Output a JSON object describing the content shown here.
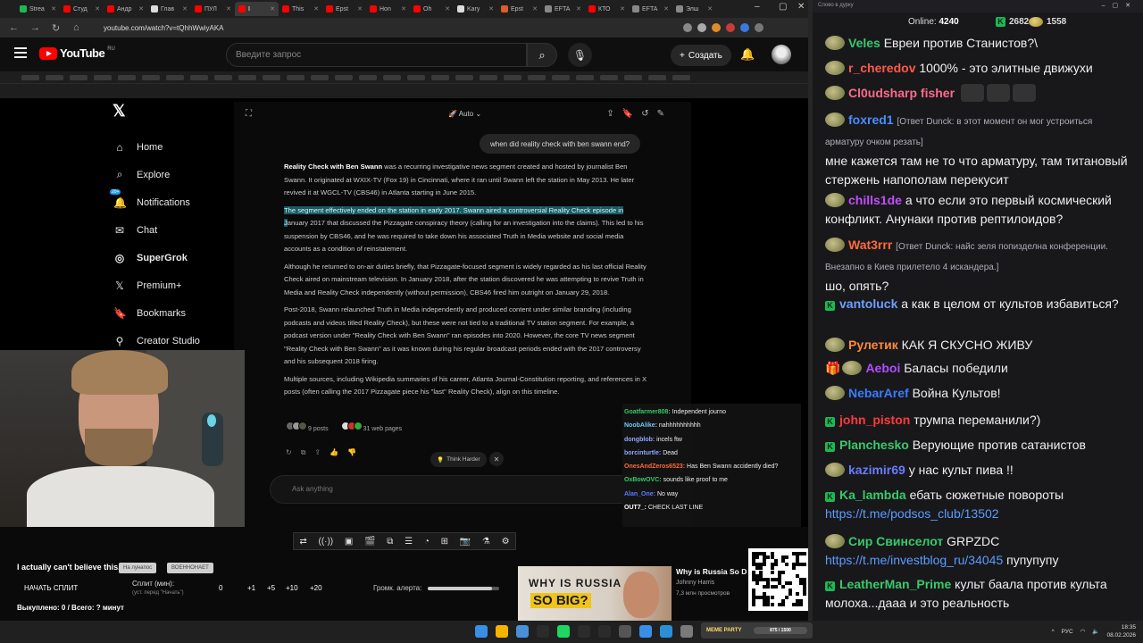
{
  "browser": {
    "tabs": [
      {
        "label": "Strea",
        "color": "#1db954"
      },
      {
        "label": "Студ",
        "color": "#ff0000"
      },
      {
        "label": "Андр",
        "color": "#ff0000"
      },
      {
        "label": "Глав",
        "color": "#dddddd"
      },
      {
        "label": "ПУЛ",
        "color": "#ff0000"
      },
      {
        "label": "I",
        "color": "#ff0000",
        "active": true
      },
      {
        "label": "This",
        "color": "#ff0000"
      },
      {
        "label": "Epst",
        "color": "#ff0000"
      },
      {
        "label": "Hon",
        "color": "#ff0000"
      },
      {
        "label": "Oh",
        "color": "#ff0000"
      },
      {
        "label": "Kary",
        "color": "#dddddd"
      },
      {
        "label": "Epst",
        "color": "#e05a2a"
      },
      {
        "label": "EFTA",
        "color": "#888888"
      },
      {
        "label": "КТО",
        "color": "#ff0000"
      },
      {
        "label": "EFTA",
        "color": "#888888"
      },
      {
        "label": "Элш",
        "color": "#888888"
      }
    ],
    "url": "youtube.com/watch?v=tQhhWwiyAKA",
    "window_controls": [
      "–",
      "▢",
      "✕"
    ]
  },
  "youtube": {
    "logo_text": "YouTube",
    "region": "RU",
    "search_placeholder": "Введите запрос",
    "create_label": "Создать"
  },
  "x_sidebar": {
    "logo": "𝕏",
    "items": [
      {
        "icon": "⌂",
        "label": "Home"
      },
      {
        "icon": "⌕",
        "label": "Explore"
      },
      {
        "icon": "🔔",
        "label": "Notifications",
        "badge": "20+"
      },
      {
        "icon": "✉",
        "label": "Chat"
      },
      {
        "icon": "◎",
        "label": "SuperGrok",
        "bold": true
      },
      {
        "icon": "𝕏",
        "label": "Premium+"
      },
      {
        "icon": "🔖",
        "label": "Bookmarks"
      },
      {
        "icon": "⚲",
        "label": "Creator Studio"
      }
    ]
  },
  "grok": {
    "mode": "Auto",
    "user_question": "when did reality check with ben swann end?",
    "answer": {
      "p1_bold": "Reality Check with Ben Swann",
      "p1_rest": " was a recurring investigative news segment created and hosted by journalist Ben Swann. It originated at WXIX-TV (Fox 19) in Cincinnati, where it ran until Swann left the station in May 2013. He later revived it at WGCL-TV (CBS46) in Atlanta starting in June 2015.",
      "p2_highlight": "The segment effectively ended on the station in early 2017. Swann aired a controversial Reality Check episode in J",
      "p2_rest": "anuary 2017 that discussed the Pizzagate conspiracy theory (calling for an investigation into the claims). This led to his suspension by CBS46, and he was required to take down his associated Truth in Media website and social media accounts as a condition of reinstatement.",
      "p3": "Although he returned to on-air duties briefly, that Pizzagate-focused segment is widely regarded as his last official Reality Check aired on mainstream television. In January 2018, after the station discovered he was attempting to revive Truth in Media and Reality Check independently (without permission), CBS46 fired him outright on January 29, 2018.",
      "p4": "Post-2018, Swann relaunched Truth in Media independently and produced content under similar branding (including podcasts and videos titled Reality Check), but these were not tied to a traditional TV station segment. For example, a podcast version under \"Reality Check with Ben Swann\" ran episodes into 2020. However, the core TV news segment \"Reality Check with Ben Swann\" as it was known during his regular broadcast periods ended with the 2017 controversy and his subsequent 2018 firing.",
      "p5": "Multiple sources, including Wikipedia summaries of his career, Atlanta Journal-Constitution reporting, and references in X posts (often calling the 2017 Pizzagate piece his \"last\" Reality Check), align on this timeline."
    },
    "posts_label": "9 posts",
    "web_pages_label": "31 web pages",
    "think_harder": "Think Harder",
    "ask_placeholder": "Ask anything"
  },
  "overlay_chat": [
    {
      "user": "Goatfarmer808:",
      "text": "Independent journo",
      "color": "#39c96b"
    },
    {
      "user": "NoobAlike:",
      "text": "nahhhhhhhhhh",
      "color": "#6ec8ff"
    },
    {
      "user": "dongblob:",
      "text": "incels ftw",
      "color": "#8fa8ff"
    },
    {
      "user": "borcinturtle:",
      "text": "Dead",
      "color": "#8fa8ff"
    },
    {
      "user": "OnesAndZeros6523:",
      "text": "Has Ben Swann accidently died?",
      "color": "#ff6a3a"
    },
    {
      "user": "OxBowOVC:",
      "text": "sounds like proof to me",
      "color": "#39c96b"
    },
    {
      "user": "Alan_One:",
      "text": "No way",
      "color": "#5b7cff"
    },
    {
      "user": "OUT7_:",
      "text": "CHECK LAST LINE",
      "color": "#ffffff"
    }
  ],
  "bottom_panel": {
    "prediction_title": "I actually can't believe this..",
    "chip1": "На лунапос",
    "chip2": "ВОЕННОНАЕТ",
    "start_split": "НАЧАТЬ СПЛИТ",
    "split_label": "Сплит (мин):",
    "split_sub": "(уст. перед \"Начать\")",
    "split_values": [
      "0",
      "+1",
      "+5",
      "+10",
      "+20"
    ],
    "alert_volume_label": "Громк. алерта:",
    "alert_volume_level": 0.9,
    "bought_line": "Выкуплено: 0 / Всего: ? минут",
    "rec_thumb_line1": "WHY IS RUSSIA",
    "rec_thumb_line2": "SO BIG?",
    "rec_title": "Why is Russia So D",
    "rec_channel": "Johnny Harris",
    "rec_views": "7,3 млн просмотров"
  },
  "taskbar": {
    "meme_party": "MEME PARTY",
    "meme_progress": "875 / 1500",
    "lang": "РУС",
    "time": "18:35",
    "date": "08.02.2026",
    "icon_colors": [
      "#3a8ee6",
      "#f4b400",
      "#4a90d9",
      "#2b2b2b",
      "#1ed760",
      "#2b2b2b",
      "#2b2b2b",
      "#555555",
      "#3a8ee6",
      "#2b8fd6",
      "#7a7a7a"
    ]
  },
  "chat": {
    "top_title": "Слово в дурку",
    "online_label": "Online:",
    "online_count": "4240",
    "points1": "2682",
    "points2": "1558",
    "messages": [
      {
        "user": "Veles",
        "color": "#39c96b",
        "badge": "pepe",
        "text": "Евреи против Станистов?\\"
      },
      {
        "user": "r_cheredov",
        "color": "#ff5a4a",
        "badge": "pepe",
        "text": "1000% - это элитные движухи"
      },
      {
        "user": "Cl0udsharp fisher",
        "color": "#ff6a8a",
        "badge": "pepe",
        "text": ""
      },
      {
        "user": "foxred1",
        "color": "#4a8cff",
        "badge": "pepe",
        "reply": "[Ответ Dunck: в этот момент он мог устроиться арматуру очком резать]",
        "text": "мне кажется там не то что арматуру, там титановый стержень напополам перекусит"
      },
      {
        "user": "chills1de",
        "color": "#c14dff",
        "badge": "pepe",
        "text": "а что если это первый космический конфликт. Анунаки против рептилоидов?"
      },
      {
        "user": "Wat3rrr",
        "color": "#ff6a3a",
        "badge": "pepe",
        "reply": "[Ответ Dunck: найс зеля попизделна конференции. Внезапно в Киев прилетело 4 искандера.]",
        "text": "шо, опять?"
      },
      {
        "user": "vantoluck",
        "color": "#6aa0ff",
        "badge": "k",
        "text": "а как в целом от культов избавиться?"
      },
      {
        "user": "Рулетик",
        "color": "#ff8a3a",
        "badge": "pepe",
        "text": "КАК Я СКУСНО ЖИВУ"
      },
      {
        "user": "Aeboi",
        "color": "#b14dff",
        "badge": "gift",
        "text": "Баласы победили"
      },
      {
        "user": "NebarAref",
        "color": "#3a7cff",
        "badge": "pepe",
        "text": "Война Культов!"
      },
      {
        "user": "john_piston",
        "color": "#ff3a3a",
        "badge": "k",
        "text": "трумпа переманили?)"
      },
      {
        "user": "Planchesko",
        "color": "#39c96b",
        "badge": "k",
        "text": "Верующие против сатанистов"
      },
      {
        "user": "kazimir69",
        "color": "#6a7cff",
        "badge": "pepe",
        "text": "у нас культ пива !!"
      },
      {
        "user": "Ka_lambda",
        "color": "#39c96b",
        "badge": "k",
        "text": "ебать сюжетные повороты",
        "link": "https://t.me/podsos_club/13502"
      },
      {
        "user": "Сир Свинселот",
        "color": "#39c96b",
        "badge": "pepe",
        "text": "GRPZDC",
        "link": "https://t.me/investblog_ru/34045",
        "link_suffix": " пупупупу"
      },
      {
        "user": "LeatherMan_Prime",
        "color": "#39c96b",
        "badge": "k",
        "text": "культ баала против культа молоха...дааа и это реальность"
      }
    ]
  }
}
